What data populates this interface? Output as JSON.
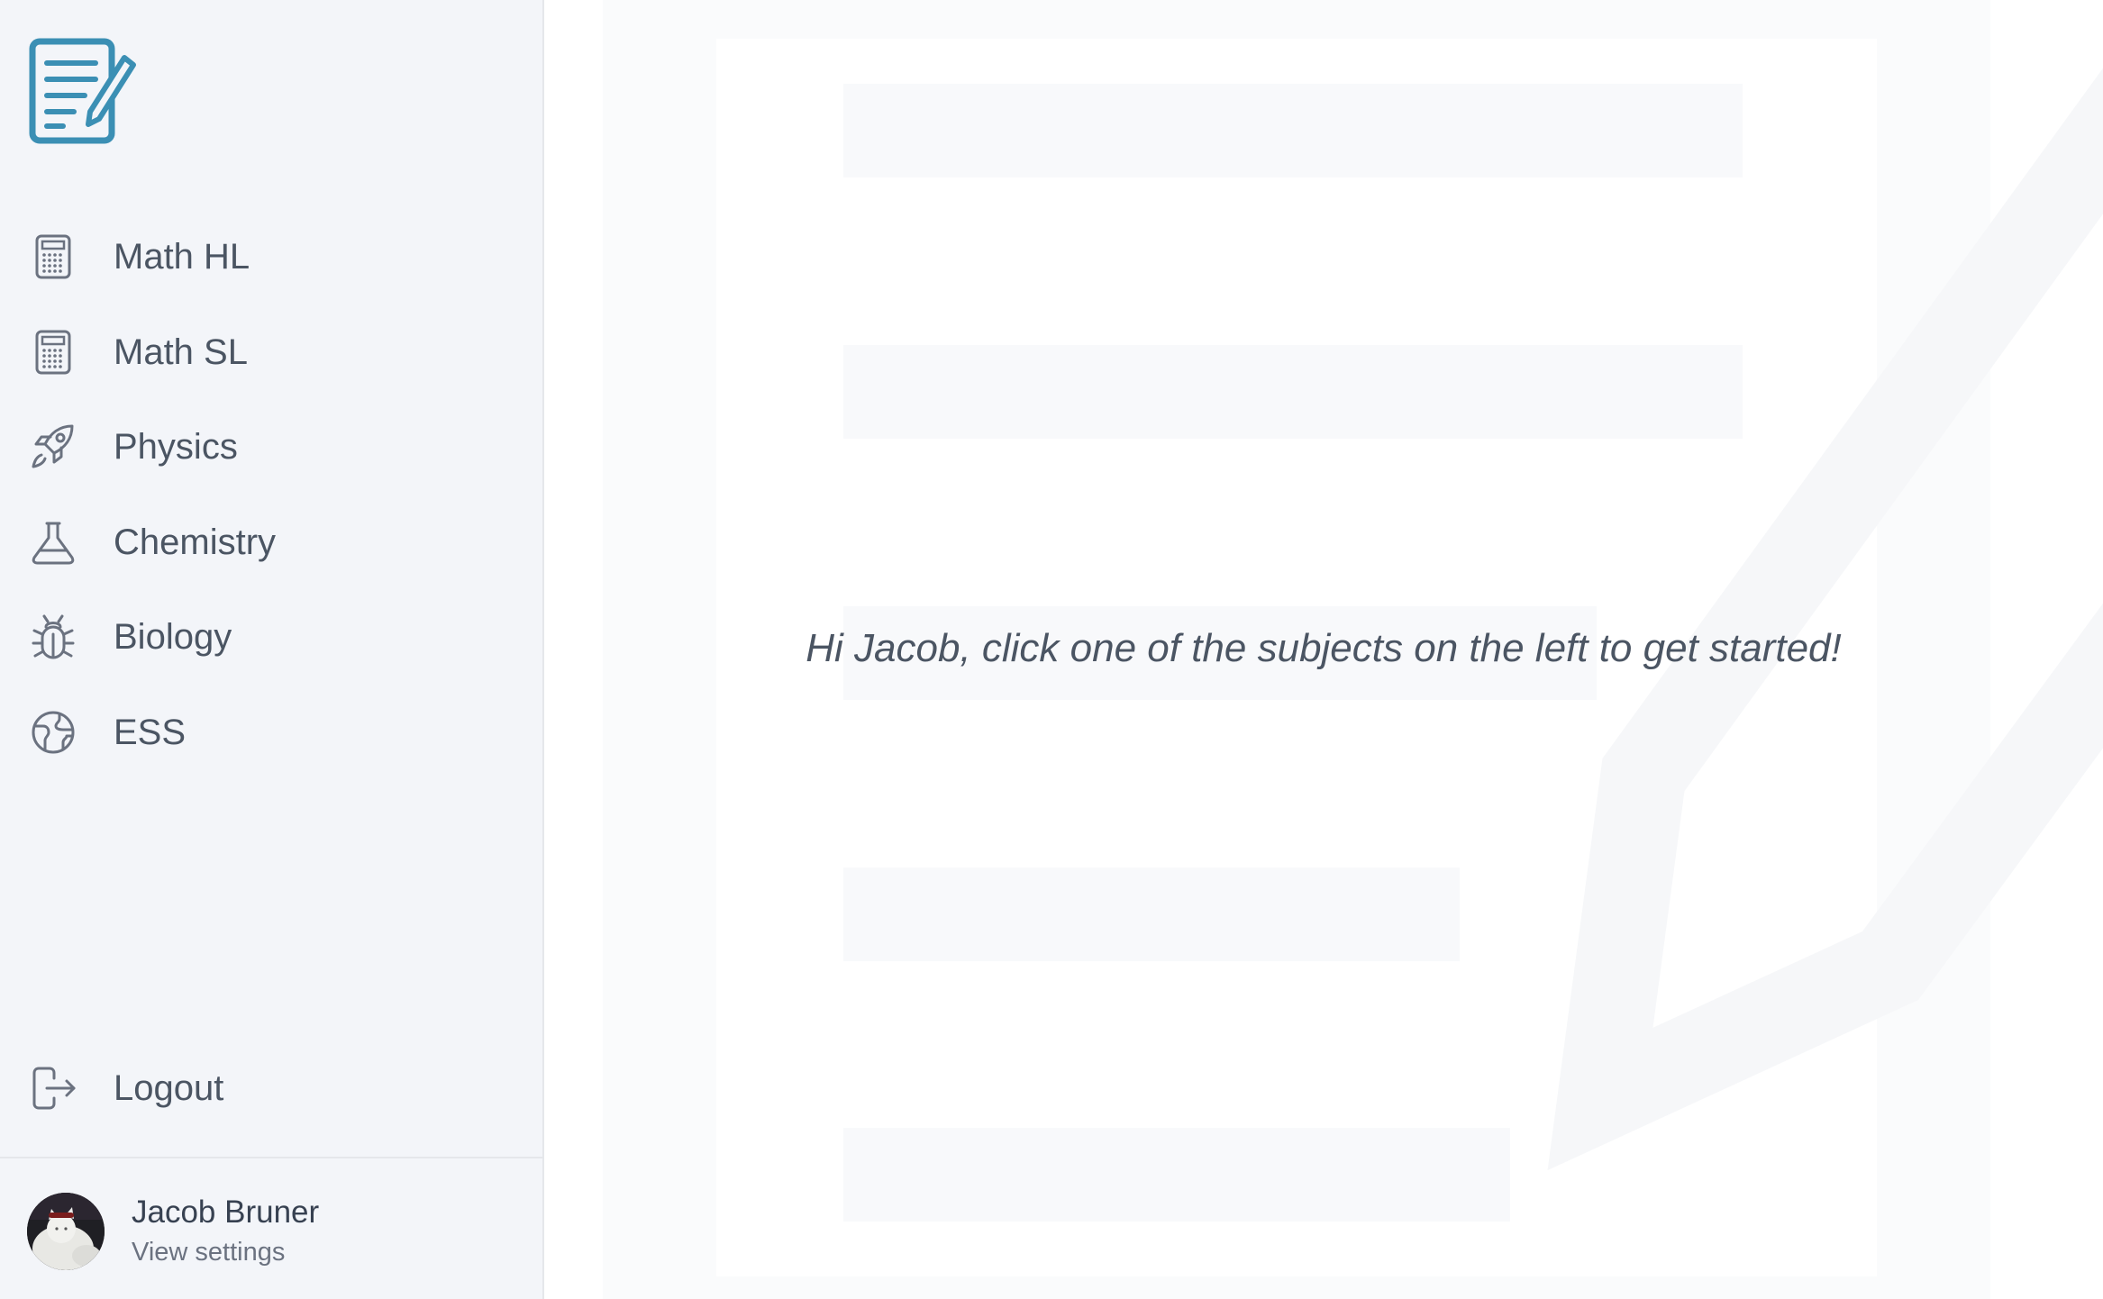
{
  "sidebar": {
    "logo_icon": "document-edit-icon",
    "items": [
      {
        "label": "Math HL",
        "icon": "calculator-icon"
      },
      {
        "label": "Math SL",
        "icon": "calculator-icon"
      },
      {
        "label": "Physics",
        "icon": "rocket-icon"
      },
      {
        "label": "Chemistry",
        "icon": "flask-icon"
      },
      {
        "label": "Biology",
        "icon": "bug-icon"
      },
      {
        "label": "ESS",
        "icon": "globe-icon"
      }
    ],
    "logout": {
      "label": "Logout",
      "icon": "logout-icon"
    }
  },
  "profile": {
    "name": "Jacob Bruner",
    "link": "View settings"
  },
  "main": {
    "welcome": "Hi Jacob, click one of the subjects on the left to get started!"
  },
  "colors": {
    "accent": "#3b8fb4",
    "sidebar_bg": "#f3f5f9",
    "nav_text": "#4b5563"
  }
}
